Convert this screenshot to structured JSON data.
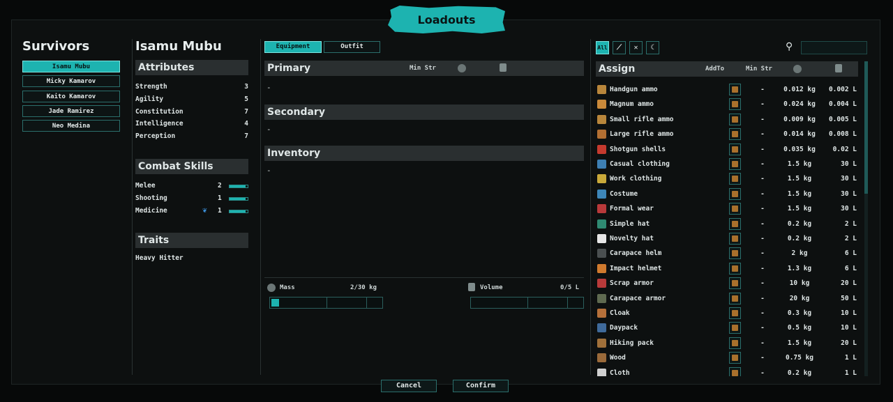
{
  "window_title": "Loadouts",
  "survivors": {
    "heading": "Survivors",
    "list": [
      "Isamu Mubu",
      "Micky Kamarov",
      "Kaito Kamarov",
      "Jade Ramirez",
      "Neo Medina"
    ],
    "selected_index": 0
  },
  "character": {
    "name": "Isamu Mubu",
    "attributes_heading": "Attributes",
    "attributes": [
      {
        "label": "Strength",
        "value": "3"
      },
      {
        "label": "Agility",
        "value": "5"
      },
      {
        "label": "Constitution",
        "value": "7"
      },
      {
        "label": "Intelligence",
        "value": "4"
      },
      {
        "label": "Perception",
        "value": "7"
      }
    ],
    "combat_heading": "Combat Skills",
    "skills": [
      {
        "label": "Melee",
        "value": "2",
        "level": 0.9
      },
      {
        "label": "Shooting",
        "value": "1",
        "level": 0.9
      },
      {
        "label": "Medicine",
        "value": "1",
        "level": 0.9
      }
    ],
    "traits_heading": "Traits",
    "traits": [
      "Heavy Hitter"
    ]
  },
  "equipment": {
    "tabs": [
      "Equipment",
      "Outfit"
    ],
    "active_tab": 0,
    "primary_heading": "Primary",
    "min_str_label": "Min Str",
    "primary_value": "-",
    "secondary_heading": "Secondary",
    "secondary_value": "-",
    "inventory_heading": "Inventory",
    "inventory_value": "-",
    "mass_label": "Mass",
    "mass_value": "2/30 kg",
    "mass_fraction": 0.067,
    "volume_label": "Volume",
    "volume_value": "0/5 L",
    "volume_fraction": 0
  },
  "assign": {
    "filters": [
      "All",
      "melee-icon",
      "rifle-icon",
      "moon-icon"
    ],
    "heading": "Assign",
    "col_add_to": "AddTo",
    "col_min_str": "Min Str",
    "items": [
      {
        "name": "Handgun ammo",
        "min_str": "-",
        "mass": "0.012 kg",
        "volume": "0.002 L",
        "color": "#b8863b"
      },
      {
        "name": "Magnum ammo",
        "min_str": "-",
        "mass": "0.024 kg",
        "volume": "0.004 L",
        "color": "#c9893a"
      },
      {
        "name": "Small rifle ammo",
        "min_str": "-",
        "mass": "0.009 kg",
        "volume": "0.005 L",
        "color": "#b8863b"
      },
      {
        "name": "Large rifle ammo",
        "min_str": "-",
        "mass": "0.014 kg",
        "volume": "0.008 L",
        "color": "#b26f32"
      },
      {
        "name": "Shotgun shells",
        "min_str": "-",
        "mass": "0.035 kg",
        "volume": "0.02 L",
        "color": "#c53a2e"
      },
      {
        "name": "Casual clothing",
        "min_str": "-",
        "mass": "1.5 kg",
        "volume": "30 L",
        "color": "#3d7fb3"
      },
      {
        "name": "Work clothing",
        "min_str": "-",
        "mass": "1.5 kg",
        "volume": "30 L",
        "color": "#c9a93a"
      },
      {
        "name": "Costume",
        "min_str": "-",
        "mass": "1.5 kg",
        "volume": "30 L",
        "color": "#3d86b8"
      },
      {
        "name": "Formal wear",
        "min_str": "-",
        "mass": "1.5 kg",
        "volume": "30 L",
        "color": "#b8393a"
      },
      {
        "name": "Simple hat",
        "min_str": "-",
        "mass": "0.2 kg",
        "volume": "2 L",
        "color": "#2f8a72"
      },
      {
        "name": "Novelty hat",
        "min_str": "-",
        "mass": "0.2 kg",
        "volume": "2 L",
        "color": "#e6e6e6"
      },
      {
        "name": "Carapace helm",
        "min_str": "-",
        "mass": "2 kg",
        "volume": "6 L",
        "color": "#4a4f50"
      },
      {
        "name": "Impact helmet",
        "min_str": "-",
        "mass": "1.3 kg",
        "volume": "6 L",
        "color": "#d07a2e"
      },
      {
        "name": "Scrap armor",
        "min_str": "-",
        "mass": "10 kg",
        "volume": "20 L",
        "color": "#b83a3a"
      },
      {
        "name": "Carapace armor",
        "min_str": "-",
        "mass": "20 kg",
        "volume": "50 L",
        "color": "#5f6a50"
      },
      {
        "name": "Cloak",
        "min_str": "-",
        "mass": "0.3 kg",
        "volume": "10 L",
        "color": "#b5703a"
      },
      {
        "name": "Daypack",
        "min_str": "-",
        "mass": "0.5 kg",
        "volume": "10 L",
        "color": "#3f6a9a"
      },
      {
        "name": "Hiking pack",
        "min_str": "-",
        "mass": "1.5 kg",
        "volume": "20 L",
        "color": "#a0703a"
      },
      {
        "name": "Wood",
        "min_str": "-",
        "mass": "0.75 kg",
        "volume": "1 L",
        "color": "#9a6a3a"
      },
      {
        "name": "Cloth",
        "min_str": "-",
        "mass": "0.2 kg",
        "volume": "1 L",
        "color": "#cfcfcf"
      }
    ]
  },
  "buttons": {
    "cancel": "Cancel",
    "confirm": "Confirm"
  }
}
